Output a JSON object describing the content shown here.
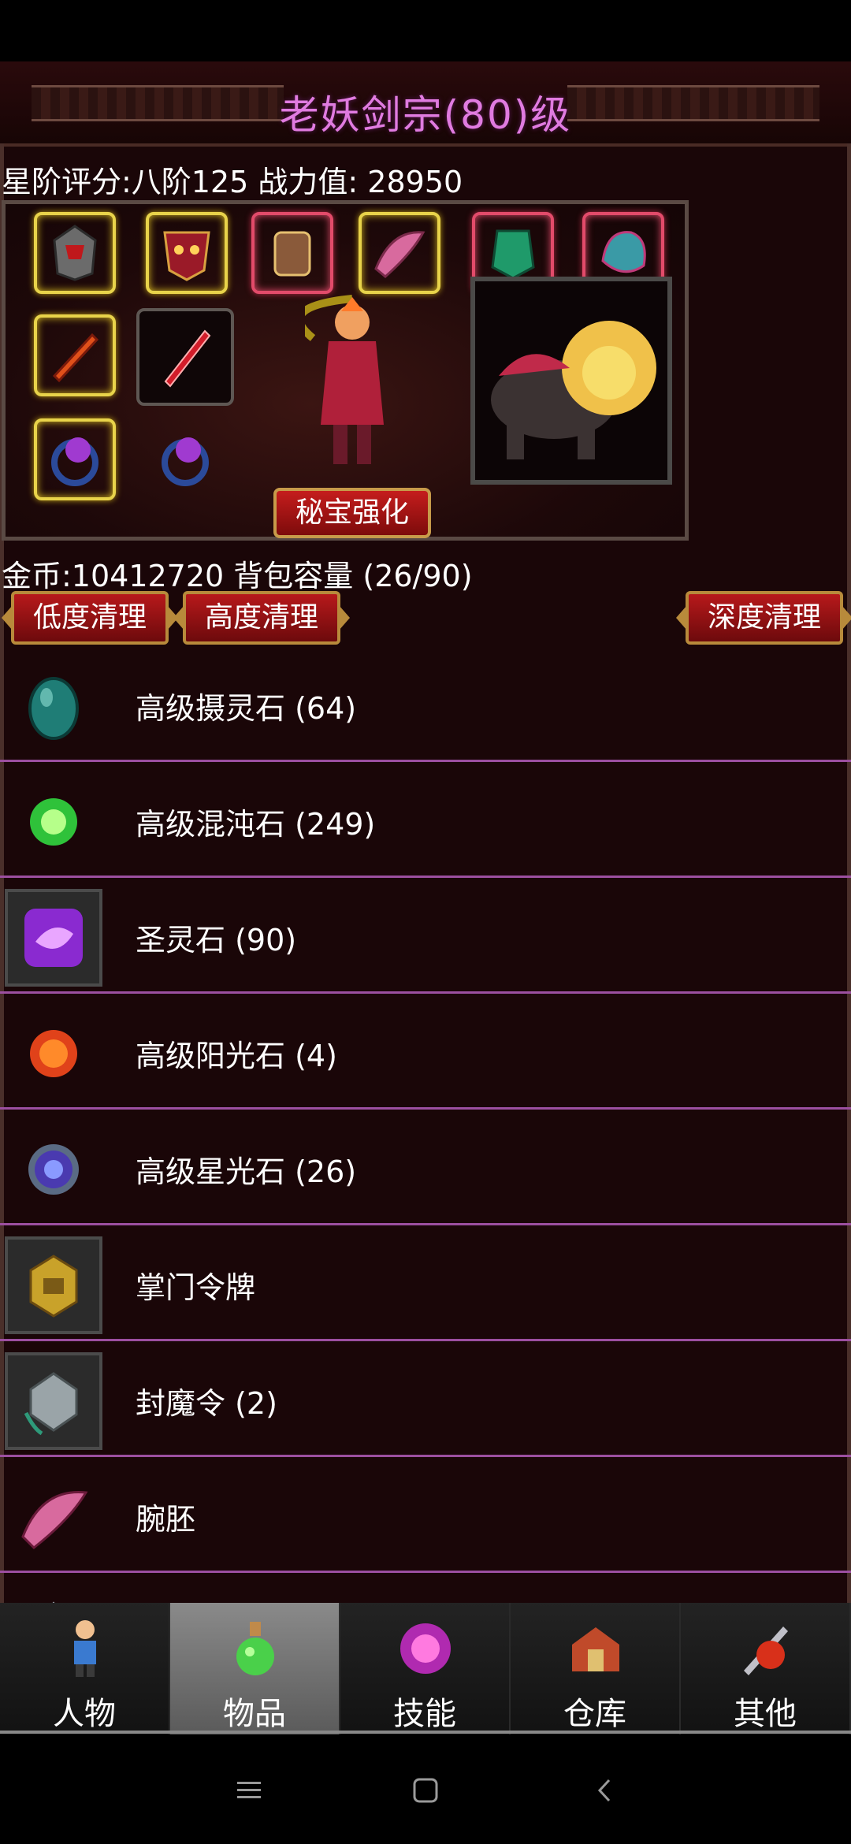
{
  "header": {
    "title": "老妖剑宗(80)级"
  },
  "stats": {
    "line": "星阶评分:八阶125 战力值: 28950"
  },
  "equipment": {
    "enhance_button": "秘宝强化"
  },
  "inventory": {
    "gold_line": "金币:10412720 背包容量 (26/90)",
    "clean_low": "低度清理",
    "clean_high": "高度清理",
    "clean_deep": "深度清理",
    "items": [
      {
        "name": "高级摄灵石 (64)",
        "icon": "teal-egg-stone-icon"
      },
      {
        "name": "高级混沌石 (249)",
        "icon": "green-chaos-orb-icon"
      },
      {
        "name": "圣灵石 (90)",
        "icon": "purple-spirit-stone-icon"
      },
      {
        "name": "高级阳光石 (4)",
        "icon": "orange-sun-stone-icon"
      },
      {
        "name": "高级星光石 (26)",
        "icon": "blue-star-stone-icon"
      },
      {
        "name": "掌门令牌",
        "icon": "gold-token-icon"
      },
      {
        "name": "封魔令 (2)",
        "icon": "silver-seal-token-icon"
      },
      {
        "name": "腕胚",
        "icon": "pink-bracer-icon"
      }
    ]
  },
  "tabs": [
    {
      "label": "人物",
      "icon": "character-icon"
    },
    {
      "label": "物品",
      "icon": "potion-icon",
      "active": true
    },
    {
      "label": "技能",
      "icon": "magic-orb-icon"
    },
    {
      "label": "仓库",
      "icon": "warehouse-chest-icon"
    },
    {
      "label": "其他",
      "icon": "sword-shield-icon"
    }
  ],
  "colors": {
    "title": "#e07be0",
    "row_divider": "#9c4fa0",
    "background": "#1a0608"
  }
}
